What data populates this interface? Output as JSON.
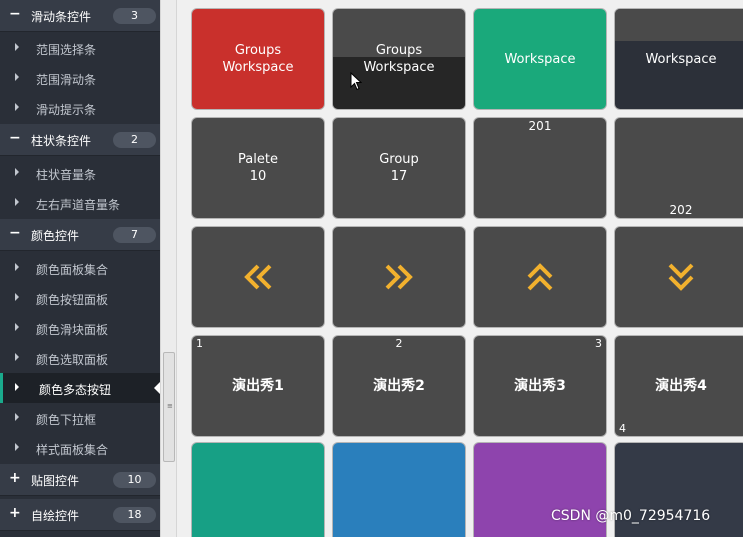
{
  "sidebar": {
    "groups": [
      {
        "sign": "−",
        "label": "滑动条控件",
        "count": "3"
      },
      {
        "sign": "−",
        "label": "柱状条控件",
        "count": "2"
      },
      {
        "sign": "−",
        "label": "颜色控件",
        "count": "7"
      },
      {
        "sign": "+",
        "label": "贴图控件",
        "count": "10"
      },
      {
        "sign": "+",
        "label": "自绘控件",
        "count": "18"
      }
    ],
    "items": [
      {
        "label": "范围选择条"
      },
      {
        "label": "范围滑动条"
      },
      {
        "label": "滑动提示条"
      },
      {
        "label": "柱状音量条"
      },
      {
        "label": "左右声道音量条"
      },
      {
        "label": "颜色面板集合"
      },
      {
        "label": "颜色按钮面板"
      },
      {
        "label": "颜色滑块面板"
      },
      {
        "label": "颜色选取面板"
      },
      {
        "label": "颜色多态按钮",
        "active": true
      },
      {
        "label": "颜色下拉框"
      },
      {
        "label": "样式面板集合"
      }
    ]
  },
  "tiles": {
    "r1": [
      {
        "line1": "Groups",
        "line2": "Workspace",
        "color": "#c9302c"
      },
      {
        "line1": "Groups",
        "line2": "Workspace",
        "color": "#4a4a4a",
        "lower_color": "#262626"
      },
      {
        "label": "Workspace",
        "color": "#1aa97b"
      },
      {
        "label": "Workspace",
        "color": "#2c3039",
        "upper_color": "#4a4a4a"
      }
    ],
    "r2": [
      {
        "line1": "Palete",
        "line2": "10"
      },
      {
        "line1": "Group",
        "line2": "17"
      },
      {
        "top_label": "201"
      },
      {
        "bottom_label": "202"
      }
    ],
    "r3": [
      {
        "icon": "double-chevron-left-icon",
        "glyph": "«"
      },
      {
        "icon": "double-chevron-right-icon",
        "glyph": "»"
      },
      {
        "icon": "double-chevron-up-icon"
      },
      {
        "icon": "double-chevron-down-icon"
      }
    ],
    "r4": [
      {
        "label": "演出秀1",
        "corner": "1"
      },
      {
        "label": "演出秀2",
        "corner": "2"
      },
      {
        "label": "演出秀3",
        "corner": "3"
      },
      {
        "label": "演出秀4",
        "corner": "4"
      }
    ],
    "r5": [
      {
        "color": "#17a085"
      },
      {
        "color": "#2a7fbc"
      },
      {
        "color": "#8e44ad"
      },
      {
        "color": "#343a47"
      }
    ],
    "arrow_color": "#f2b12e"
  },
  "watermark": "CSDN @m0_72954716"
}
